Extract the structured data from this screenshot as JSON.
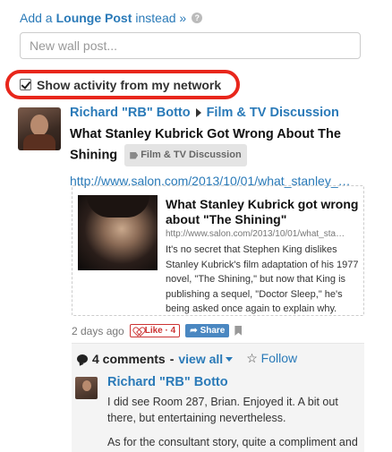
{
  "composer": {
    "add_prefix": "Add a ",
    "add_bold": "Lounge Post",
    "add_suffix": " instead »",
    "input_placeholder": "New wall post...",
    "show_activity_label": "Show activity from my network"
  },
  "post": {
    "author": "Richard \"RB\" Botto",
    "group": "Film & TV Discussion",
    "title": "What Stanley Kubrick Got Wrong About The Shining",
    "tag": "Film & TV Discussion",
    "link": "http://www.salon.com/2013/10/01/what_stanley_…",
    "preview": {
      "title": "What Stanley Kubrick got wrong about \"The Shining\"",
      "url": "http://www.salon.com/2013/10/01/what_sta…",
      "description": "It's no secret that Stephen King dislikes Stanley Kubrick's film adaptation of his 1977 novel, \"The Shining,\" but now that King is publishing a sequel, \"Doctor Sleep,\" he's being asked once again to explain why."
    },
    "timestamp": "2 days ago",
    "like_label": "Like · 4",
    "share_label": "Share"
  },
  "comments": {
    "count_label": "4 comments",
    "separator": " - ",
    "view_all_label": "view all",
    "follow_label": "Follow",
    "first": {
      "author": "Richard \"RB\" Botto",
      "text_1": "I did see Room 287, Brian. Enjoyed it. A bit out there, but entertaining nevertheless.",
      "text_2": "As for the consultant story, quite a compliment and"
    }
  },
  "colors": {
    "link": "#2a7ab8",
    "highlight_ring": "#e8261b",
    "like": "#cc3333",
    "share": "#4a87c1"
  },
  "icons": [
    "help-icon",
    "checkbox-checked",
    "arrow-right-icon",
    "tag-icon",
    "heart-icon",
    "share-icon",
    "bookmark-icon",
    "comment-bubble-icon",
    "chevron-down-icon",
    "star-icon"
  ]
}
